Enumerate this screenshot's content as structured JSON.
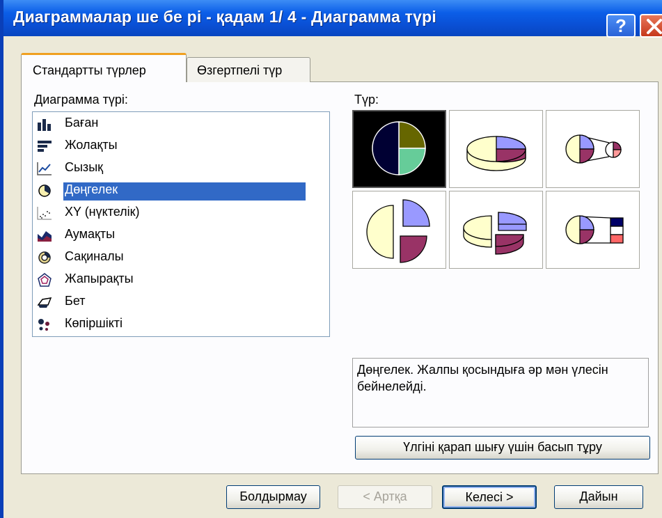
{
  "window": {
    "title": "Диаграммалар ше бе рі - қадам 1/ 4 - Диаграмма түрі"
  },
  "tabs": [
    {
      "label": "Стандартты түрлер",
      "active": true
    },
    {
      "label": "Өзгертпелі түр",
      "active": false
    }
  ],
  "chart_type_label": "Диаграмма түрі:",
  "subtype_label": "Түр:",
  "chart_types": [
    {
      "label": "Баған",
      "icon": "column-chart-icon"
    },
    {
      "label": "Жолақты",
      "icon": "bar-chart-icon"
    },
    {
      "label": "Сызық",
      "icon": "line-chart-icon"
    },
    {
      "label": "Дөңгелек",
      "icon": "pie-chart-icon",
      "selected": true
    },
    {
      "label": "XY (нүктелік)",
      "icon": "scatter-chart-icon"
    },
    {
      "label": "Аумақты",
      "icon": "area-chart-icon"
    },
    {
      "label": "Сақиналы",
      "icon": "doughnut-chart-icon"
    },
    {
      "label": "Жапырақты",
      "icon": "radar-chart-icon"
    },
    {
      "label": "Бет",
      "icon": "surface-chart-icon"
    },
    {
      "label": "Көпіршікті",
      "icon": "bubble-chart-icon"
    }
  ],
  "subtypes": [
    {
      "name": "pie",
      "selected": true
    },
    {
      "name": "pie-3d"
    },
    {
      "name": "pie-of-pie"
    },
    {
      "name": "exploded-pie"
    },
    {
      "name": "exploded-pie-3d"
    },
    {
      "name": "bar-of-pie"
    }
  ],
  "description": "Дөңгелек. Жалпы қосындыға әр мән үлесін бейнелейді.",
  "buttons": {
    "preview": "Үлгіні қарап шығу үшін басып тұру",
    "cancel": "Болдырмау",
    "back": "< Артқа",
    "next": "Келесі >",
    "finish": "Дайын"
  },
  "colors": {
    "title_bar": "#0a4fd4",
    "selection": "#3169c6",
    "pie_olive": "#666600",
    "pie_blue": "#9999ff",
    "pie_maroon": "#993366",
    "pie_cream": "#ffffcc",
    "pie_green": "#66cc99",
    "pie_navy": "#000033"
  }
}
